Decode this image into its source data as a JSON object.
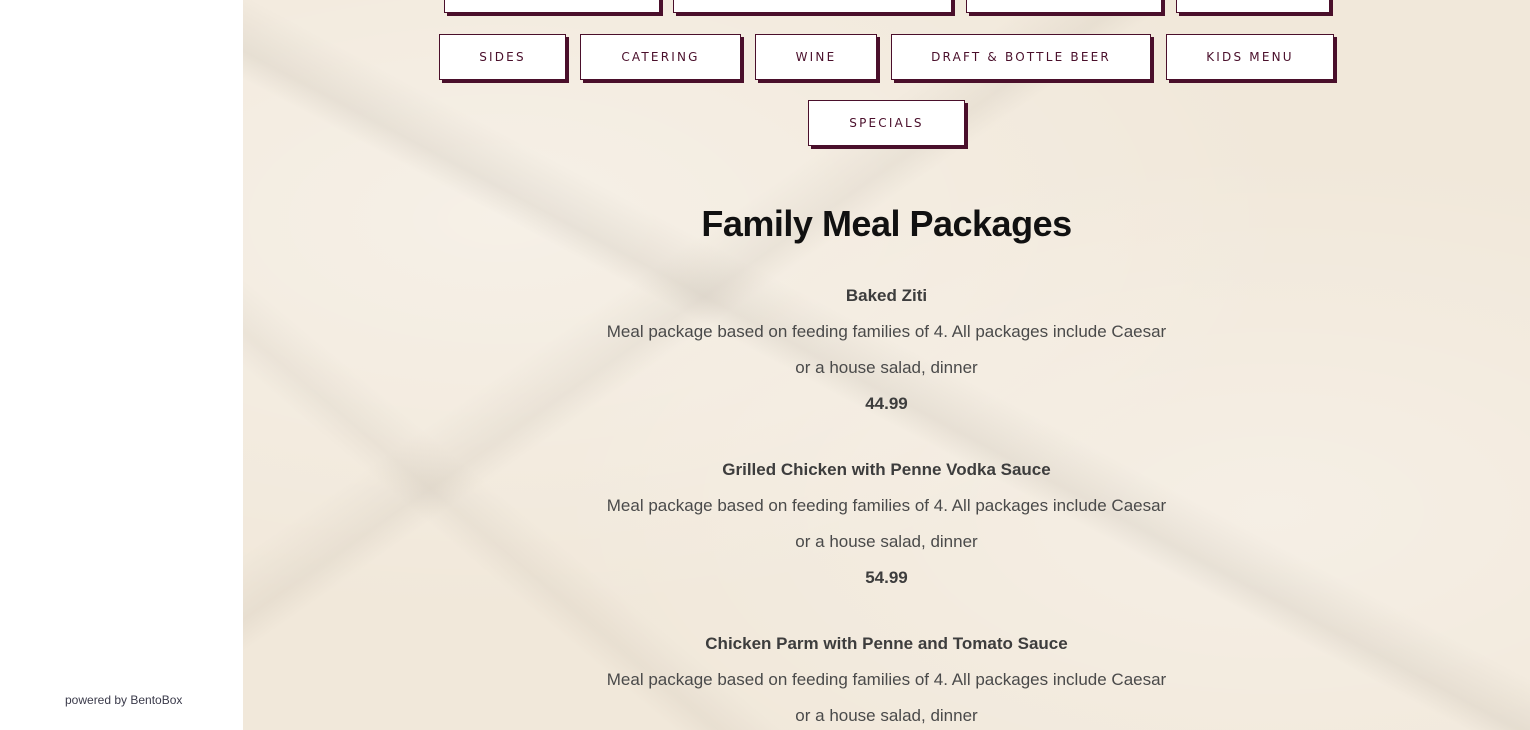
{
  "sidebar": {
    "powered_prefix": "powered by ",
    "powered_link": "BentoBox"
  },
  "nav": {
    "tabs": [
      "SIDES",
      "CATERING",
      "WINE",
      "DRAFT & BOTTLE BEER",
      "KIDS MENU",
      "SPECIALS"
    ]
  },
  "section": {
    "title": "Family Meal Packages",
    "items": [
      {
        "name": "Baked Ziti",
        "description": "Meal package based on feeding families of 4. All packages include Caesar or a house salad, dinner",
        "price": "44.99"
      },
      {
        "name": "Grilled Chicken with Penne Vodka Sauce",
        "description": "Meal package based on feeding families of 4. All packages include Caesar or a house salad, dinner",
        "price": "54.99"
      },
      {
        "name": "Chicken Parm with Penne and Tomato Sauce",
        "description": "Meal package based on feeding families of 4. All packages include Caesar or a house salad, dinner",
        "price": ""
      }
    ]
  },
  "colors": {
    "accent": "#4a0f2b",
    "background": "#f1e8da"
  }
}
